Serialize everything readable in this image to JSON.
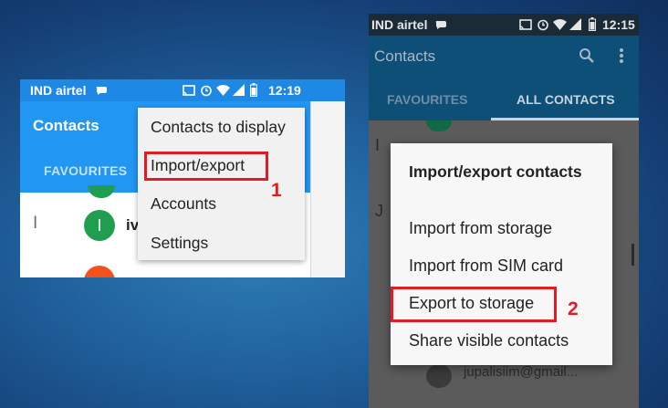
{
  "left": {
    "status": {
      "carrier": "IND airtel",
      "time": "12:19"
    },
    "app_title": "Contacts",
    "tab_favourites": "FAVOURITES",
    "section_letter": "I",
    "contact_initial": "I",
    "contact_name_partial": "iv",
    "menu": {
      "items": [
        "Contacts to display",
        "Import/export",
        "Accounts",
        "Settings"
      ]
    },
    "step_label": "1"
  },
  "right": {
    "status": {
      "carrier": "IND airtel",
      "time": "12:15"
    },
    "app_title": "Contacts",
    "tabs": [
      "FAVOURITES",
      "ALL CONTACTS"
    ],
    "section_letters": [
      "I",
      "J"
    ],
    "behind_text": "jupalisiim@gmail...",
    "dialog": {
      "title": "Import/export contacts",
      "options": [
        "Import from storage",
        "Import from SIM card",
        "Export to storage",
        "Share visible contacts"
      ]
    },
    "step_label": "2"
  },
  "colors": {
    "highlight": "#e31b23",
    "left_appbar": "#2196f3",
    "right_appbar_dimmed": "#0e4f78",
    "avatar_green": "#1e9e4e",
    "avatar_orange": "#f4511e"
  }
}
